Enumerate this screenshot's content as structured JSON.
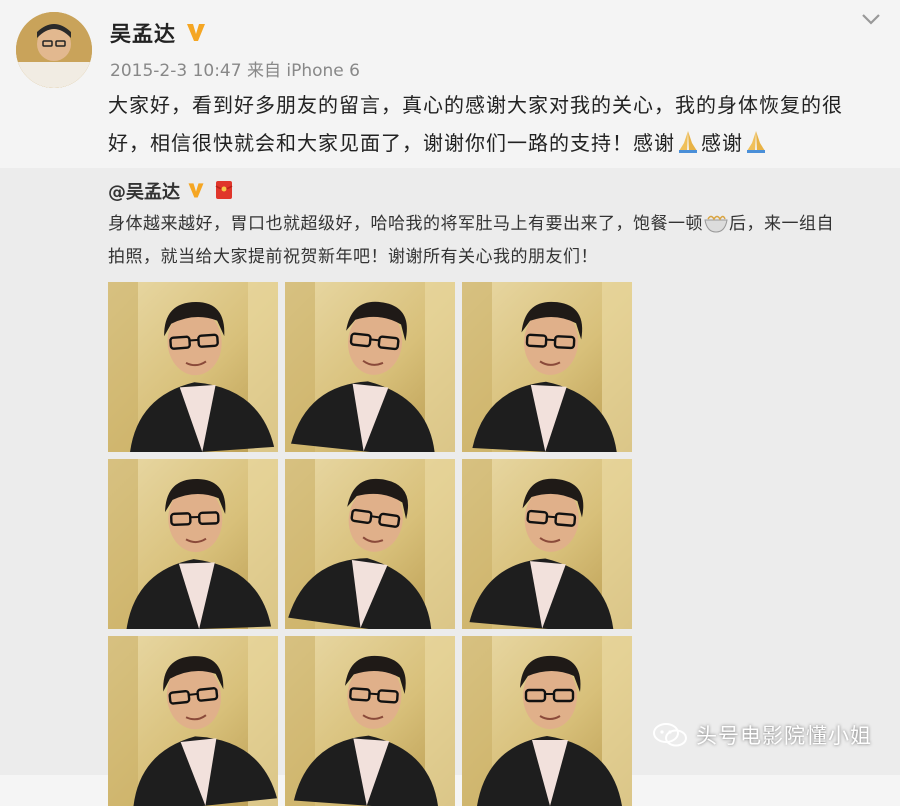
{
  "post": {
    "author": "吴孟达",
    "meta": "2015-2-3 10:47 来自 iPhone 6",
    "text_line1": "大家好，看到好多朋友的留言，真心的感谢大家对我的关心，我的身体恢复的很",
    "text_line2a": "好，相信很快就会和大家见面了，谢谢你们一路的支持！感谢",
    "text_line2b": "感谢",
    "icons": [
      "verified-v-icon",
      "chevron-down-icon",
      "pray-emoji-icon"
    ]
  },
  "repost": {
    "author": "@吴孟达",
    "text_line1a": "身体越来越好，胃口也就超级好，哈哈我的将军肚马上有要出来了，饱餐一顿",
    "text_line1b": "后，来一组自",
    "text_line2": "拍照，就当给大家提前祝贺新年吧！谢谢所有关心我的朋友们！",
    "photo_count": 9,
    "icons": [
      "verified-v-icon",
      "red-envelope-icon",
      "noodle-bowl-emoji-icon"
    ]
  },
  "watermark": {
    "text": "头号电影院懂小姐"
  },
  "colors": {
    "verified": "#f5a623",
    "text": "#333333",
    "meta": "#888888",
    "repost_bg": "#ececec"
  }
}
